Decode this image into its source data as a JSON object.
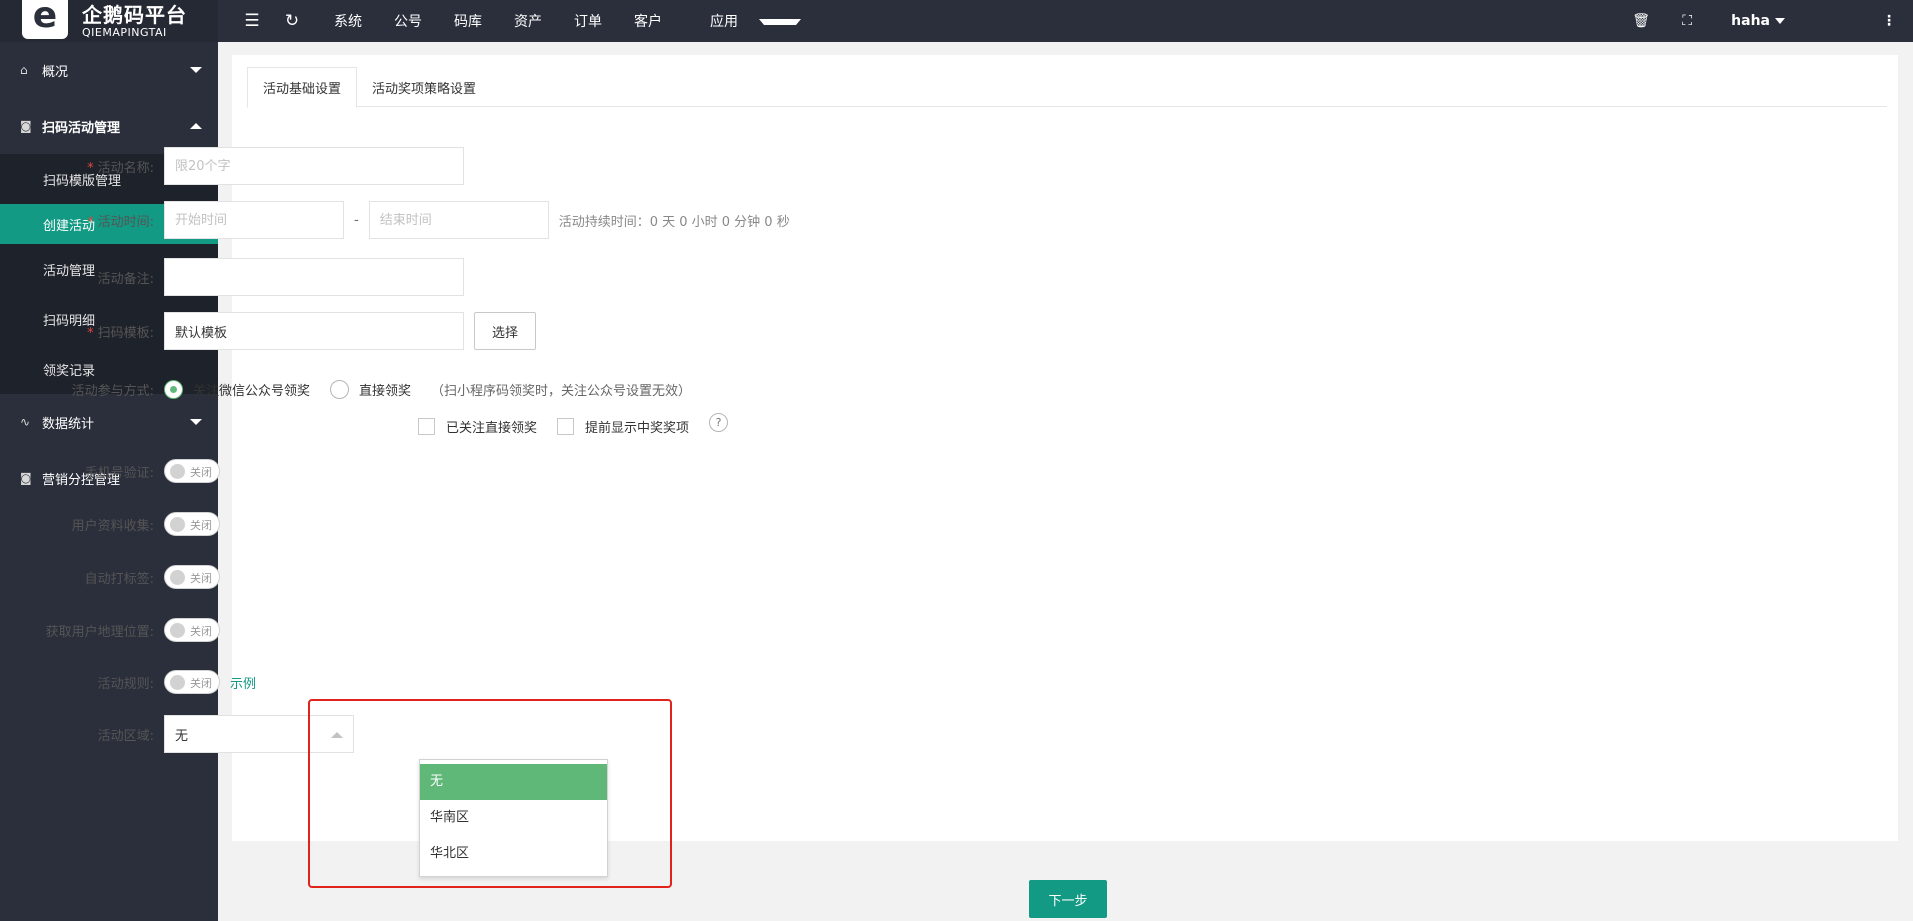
{
  "brand": {
    "logo_letter": "e",
    "name_cn": "企鹅码平台",
    "name_en": "QIEMAPINGTAI"
  },
  "sidebar": {
    "groups": [
      {
        "label": "概况",
        "icon": "home-icon"
      },
      {
        "label": "扫码活动管理",
        "icon": "camera-icon",
        "expanded": true
      },
      {
        "label": "数据统计",
        "icon": "pulse-chart-icon"
      },
      {
        "label": "营销分控管理",
        "icon": "camera-icon"
      }
    ],
    "sub_items": [
      {
        "label": "扫码模版管理"
      },
      {
        "label": "创建活动",
        "active": true
      },
      {
        "label": "活动管理"
      },
      {
        "label": "扫码明细"
      },
      {
        "label": "领奖记录"
      }
    ]
  },
  "topbar": {
    "nav": [
      "系统",
      "公号",
      "码库",
      "资产",
      "订单",
      "客户",
      "应用"
    ],
    "user": "haha"
  },
  "tabs": [
    {
      "label": "活动基础设置",
      "active": true
    },
    {
      "label": "活动奖项策略设置"
    }
  ],
  "form": {
    "name": {
      "label": "活动名称:",
      "placeholder": "限20个字"
    },
    "time": {
      "label": "活动时间:",
      "start_placeholder": "开始时间",
      "separator": "-",
      "end_placeholder": "结束时间",
      "duration": "活动持续时间：0 天 0 小时 0 分钟 0 秒"
    },
    "remark": {
      "label": "活动备注:",
      "value": ""
    },
    "template": {
      "label": "扫码模板:",
      "value": "默认模板",
      "button": "选择"
    },
    "participation": {
      "label": "活动参与方式:",
      "options": [
        "关注微信公众号领奖",
        "直接领奖"
      ],
      "selected": 0,
      "hint": "（扫小程序码领奖时，关注公众号设置无效）",
      "checks": [
        "已关注直接领奖",
        "提前显示中奖奖项"
      ],
      "help": "?"
    },
    "phone_verify": {
      "label": "手机号验证:",
      "state": "关闭"
    },
    "user_info": {
      "label": "用户资料收集:",
      "state": "关闭"
    },
    "auto_tag": {
      "label": "自动打标签:",
      "state": "关闭"
    },
    "geo": {
      "label": "获取用户地理位置:",
      "state": "关闭"
    },
    "rules": {
      "label": "活动规则:",
      "state": "关闭",
      "link": "示例"
    },
    "region": {
      "label": "活动区域:",
      "value": "无",
      "options": [
        "无",
        "华南区",
        "华北区"
      ],
      "selected": 0
    }
  },
  "next_button": "下一步",
  "colors": {
    "sidebar_bg": "#2a2f3b",
    "accent": "#129a85",
    "radio_green": "#5fb878",
    "highlight_red": "#e0231b"
  }
}
